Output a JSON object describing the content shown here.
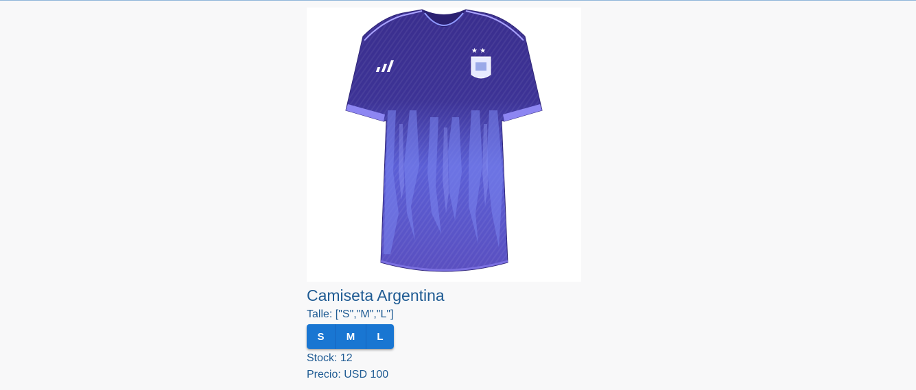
{
  "product": {
    "image_alt": "Camiseta Argentina",
    "title": "Camiseta Argentina",
    "sizes_text": "Talle: [\"S\",\"M\",\"L\"]",
    "size_buttons": [
      {
        "label": "S"
      },
      {
        "label": "M"
      },
      {
        "label": "L"
      }
    ],
    "stock_text": "Stock: 12",
    "price_text": "Precio: USD 100"
  },
  "colors": {
    "background": "#f8f8f9",
    "text": "#1f5b93",
    "button": "#1976d2",
    "jersey_primary": "#3b2f8f",
    "jersey_accent": "#6f78e6"
  }
}
